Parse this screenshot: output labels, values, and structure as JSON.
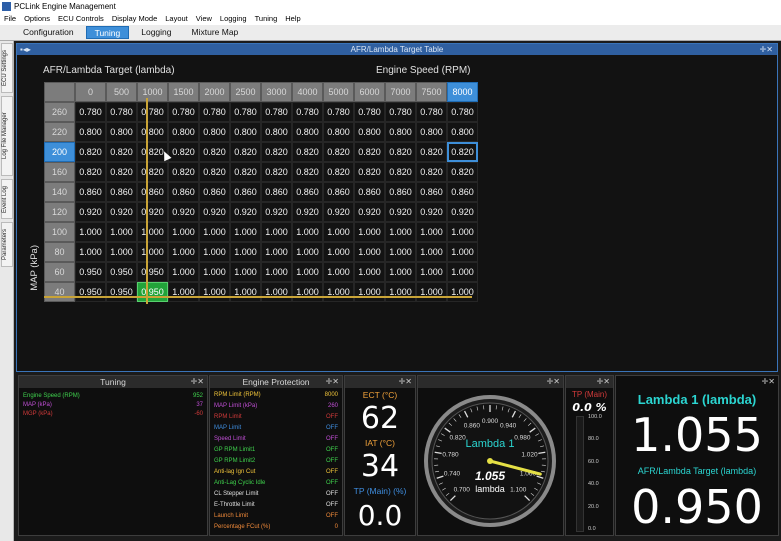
{
  "window": {
    "title": "PCLink Engine Management"
  },
  "menu": [
    "File",
    "Options",
    "ECU Controls",
    "Display Mode",
    "Layout",
    "View",
    "Logging",
    "Tuning",
    "Help"
  ],
  "tabs": [
    {
      "label": "Configuration",
      "active": false
    },
    {
      "label": "Tuning",
      "active": true
    },
    {
      "label": "Logging",
      "active": false
    },
    {
      "label": "Mixture Map",
      "active": false
    }
  ],
  "side_tabs": [
    "ECU Settings",
    "Log File Manager",
    "Event Log",
    "Parameters"
  ],
  "table_panel": {
    "title": "AFR/Lambda Target Table",
    "table_label": "AFR/Lambda Target (lambda)",
    "x_axis_label": "Engine Speed (RPM)",
    "y_axis_label": "MAP (kPa)",
    "rpm": [
      "0",
      "500",
      "1000",
      "1500",
      "2000",
      "2500",
      "3000",
      "4000",
      "5000",
      "6000",
      "7000",
      "7500",
      "8000"
    ],
    "selected_rpm_index": 12,
    "selected_map_index": 2,
    "rows": [
      {
        "map": "260",
        "values": [
          "0.780",
          "0.780",
          "0.780",
          "0.780",
          "0.780",
          "0.780",
          "0.780",
          "0.780",
          "0.780",
          "0.780",
          "0.780",
          "0.780",
          "0.780"
        ]
      },
      {
        "map": "220",
        "values": [
          "0.800",
          "0.800",
          "0.800",
          "0.800",
          "0.800",
          "0.800",
          "0.800",
          "0.800",
          "0.800",
          "0.800",
          "0.800",
          "0.800",
          "0.800"
        ]
      },
      {
        "map": "200",
        "values": [
          "0.820",
          "0.820",
          "0.820",
          "0.820",
          "0.820",
          "0.820",
          "0.820",
          "0.820",
          "0.820",
          "0.820",
          "0.820",
          "0.820",
          "0.820"
        ]
      },
      {
        "map": "160",
        "values": [
          "0.820",
          "0.820",
          "0.820",
          "0.820",
          "0.820",
          "0.820",
          "0.820",
          "0.820",
          "0.820",
          "0.820",
          "0.820",
          "0.820",
          "0.820"
        ]
      },
      {
        "map": "140",
        "values": [
          "0.860",
          "0.860",
          "0.860",
          "0.860",
          "0.860",
          "0.860",
          "0.860",
          "0.860",
          "0.860",
          "0.860",
          "0.860",
          "0.860",
          "0.860"
        ]
      },
      {
        "map": "120",
        "values": [
          "0.920",
          "0.920",
          "0.920",
          "0.920",
          "0.920",
          "0.920",
          "0.920",
          "0.920",
          "0.920",
          "0.920",
          "0.920",
          "0.920",
          "0.920"
        ]
      },
      {
        "map": "100",
        "values": [
          "1.000",
          "1.000",
          "1.000",
          "1.000",
          "1.000",
          "1.000",
          "1.000",
          "1.000",
          "1.000",
          "1.000",
          "1.000",
          "1.000",
          "1.000"
        ]
      },
      {
        "map": "80",
        "values": [
          "1.000",
          "1.000",
          "1.000",
          "1.000",
          "1.000",
          "1.000",
          "1.000",
          "1.000",
          "1.000",
          "1.000",
          "1.000",
          "1.000",
          "1.000"
        ]
      },
      {
        "map": "60",
        "values": [
          "0.950",
          "0.950",
          "0.950",
          "1.000",
          "1.000",
          "1.000",
          "1.000",
          "1.000",
          "1.000",
          "1.000",
          "1.000",
          "1.000",
          "1.000"
        ]
      },
      {
        "map": "40",
        "values": [
          "0.950",
          "0.950",
          "0.950",
          "1.000",
          "1.000",
          "1.000",
          "1.000",
          "1.000",
          "1.000",
          "1.000",
          "1.000",
          "1.000",
          "1.000"
        ]
      }
    ],
    "active_cell": {
      "row": 9,
      "col": 2
    }
  },
  "tuning_panel": {
    "title": "Tuning",
    "rows": [
      {
        "label": "Engine Speed (RPM)",
        "value": "952",
        "color": "#3fd24d"
      },
      {
        "label": "MAP (kPa)",
        "value": "37",
        "color": "#c14fd6"
      },
      {
        "label": "MGP (kPa)",
        "value": "-60",
        "color": "#d13a3a"
      }
    ]
  },
  "protection_panel": {
    "title": "Engine Protection",
    "rows": [
      {
        "label": "RPM Limit (RPM)",
        "value": "8000",
        "color": "#f0c43a"
      },
      {
        "label": "MAP Limit (kPa)",
        "value": "260",
        "color": "#c14fd6"
      },
      {
        "label": "RPM Limit",
        "value": "OFF",
        "color": "#d13a3a"
      },
      {
        "label": "MAP Limit",
        "value": "OFF",
        "color": "#3f8ee0"
      },
      {
        "label": "Speed Limit",
        "value": "OFF",
        "color": "#c14fd6"
      },
      {
        "label": "GP RPM Limit1",
        "value": "OFF",
        "color": "#3fd24d"
      },
      {
        "label": "GP RPM Limit2",
        "value": "OFF",
        "color": "#3fd24d"
      },
      {
        "label": "Anti-lag Ign Cut",
        "value": "OFF",
        "color": "#f0c43a"
      },
      {
        "label": "Anti-Lag Cyclic Idle",
        "value": "OFF",
        "color": "#3fd24d"
      },
      {
        "label": "CL Stepper Limit",
        "value": "OFF",
        "color": "#e0e0e0"
      },
      {
        "label": "E-Throttle Limit",
        "value": "OFF",
        "color": "#e0e0e0"
      },
      {
        "label": "Launch Limit",
        "value": "OFF",
        "color": "#f08a3a"
      },
      {
        "label": "Percentage FCut (%)",
        "value": "0",
        "color": "#f08a3a"
      }
    ]
  },
  "readouts": {
    "ect_label": "ECT (°C)",
    "ect_value": "62",
    "iat_label": "IAT (°C)",
    "iat_value": "34",
    "tp_label": "TP (Main) (%)",
    "tp_value": "0.0"
  },
  "dial": {
    "name": "Lambda 1",
    "value": "1.055",
    "unit": "lambda",
    "ticks": [
      "0.700",
      "0.740",
      "0.780",
      "0.820",
      "0.860",
      "0.900",
      "0.940",
      "0.980",
      "1.020",
      "1.060",
      "1.100"
    ],
    "min": 0.7,
    "max": 1.1,
    "reading": 1.055
  },
  "tp_bar": {
    "title": "TP (Main)",
    "value": "0.0 %",
    "ticks": [
      "100.0",
      "80.0",
      "60.0",
      "40.0",
      "20.0",
      "0.0"
    ],
    "level": 0
  },
  "lambda_panel": {
    "lambda_title": "Lambda 1 (lambda)",
    "lambda_value": "1.055",
    "target_title": "AFR/Lambda Target (lambda)",
    "target_value": "0.950"
  },
  "colors": {
    "accent": "#3e8fd9",
    "active_cell": "#22a33a",
    "trace": "#c9a437",
    "gauge_title": "#f0a13a",
    "lambda_title": "#2bd5d1"
  }
}
